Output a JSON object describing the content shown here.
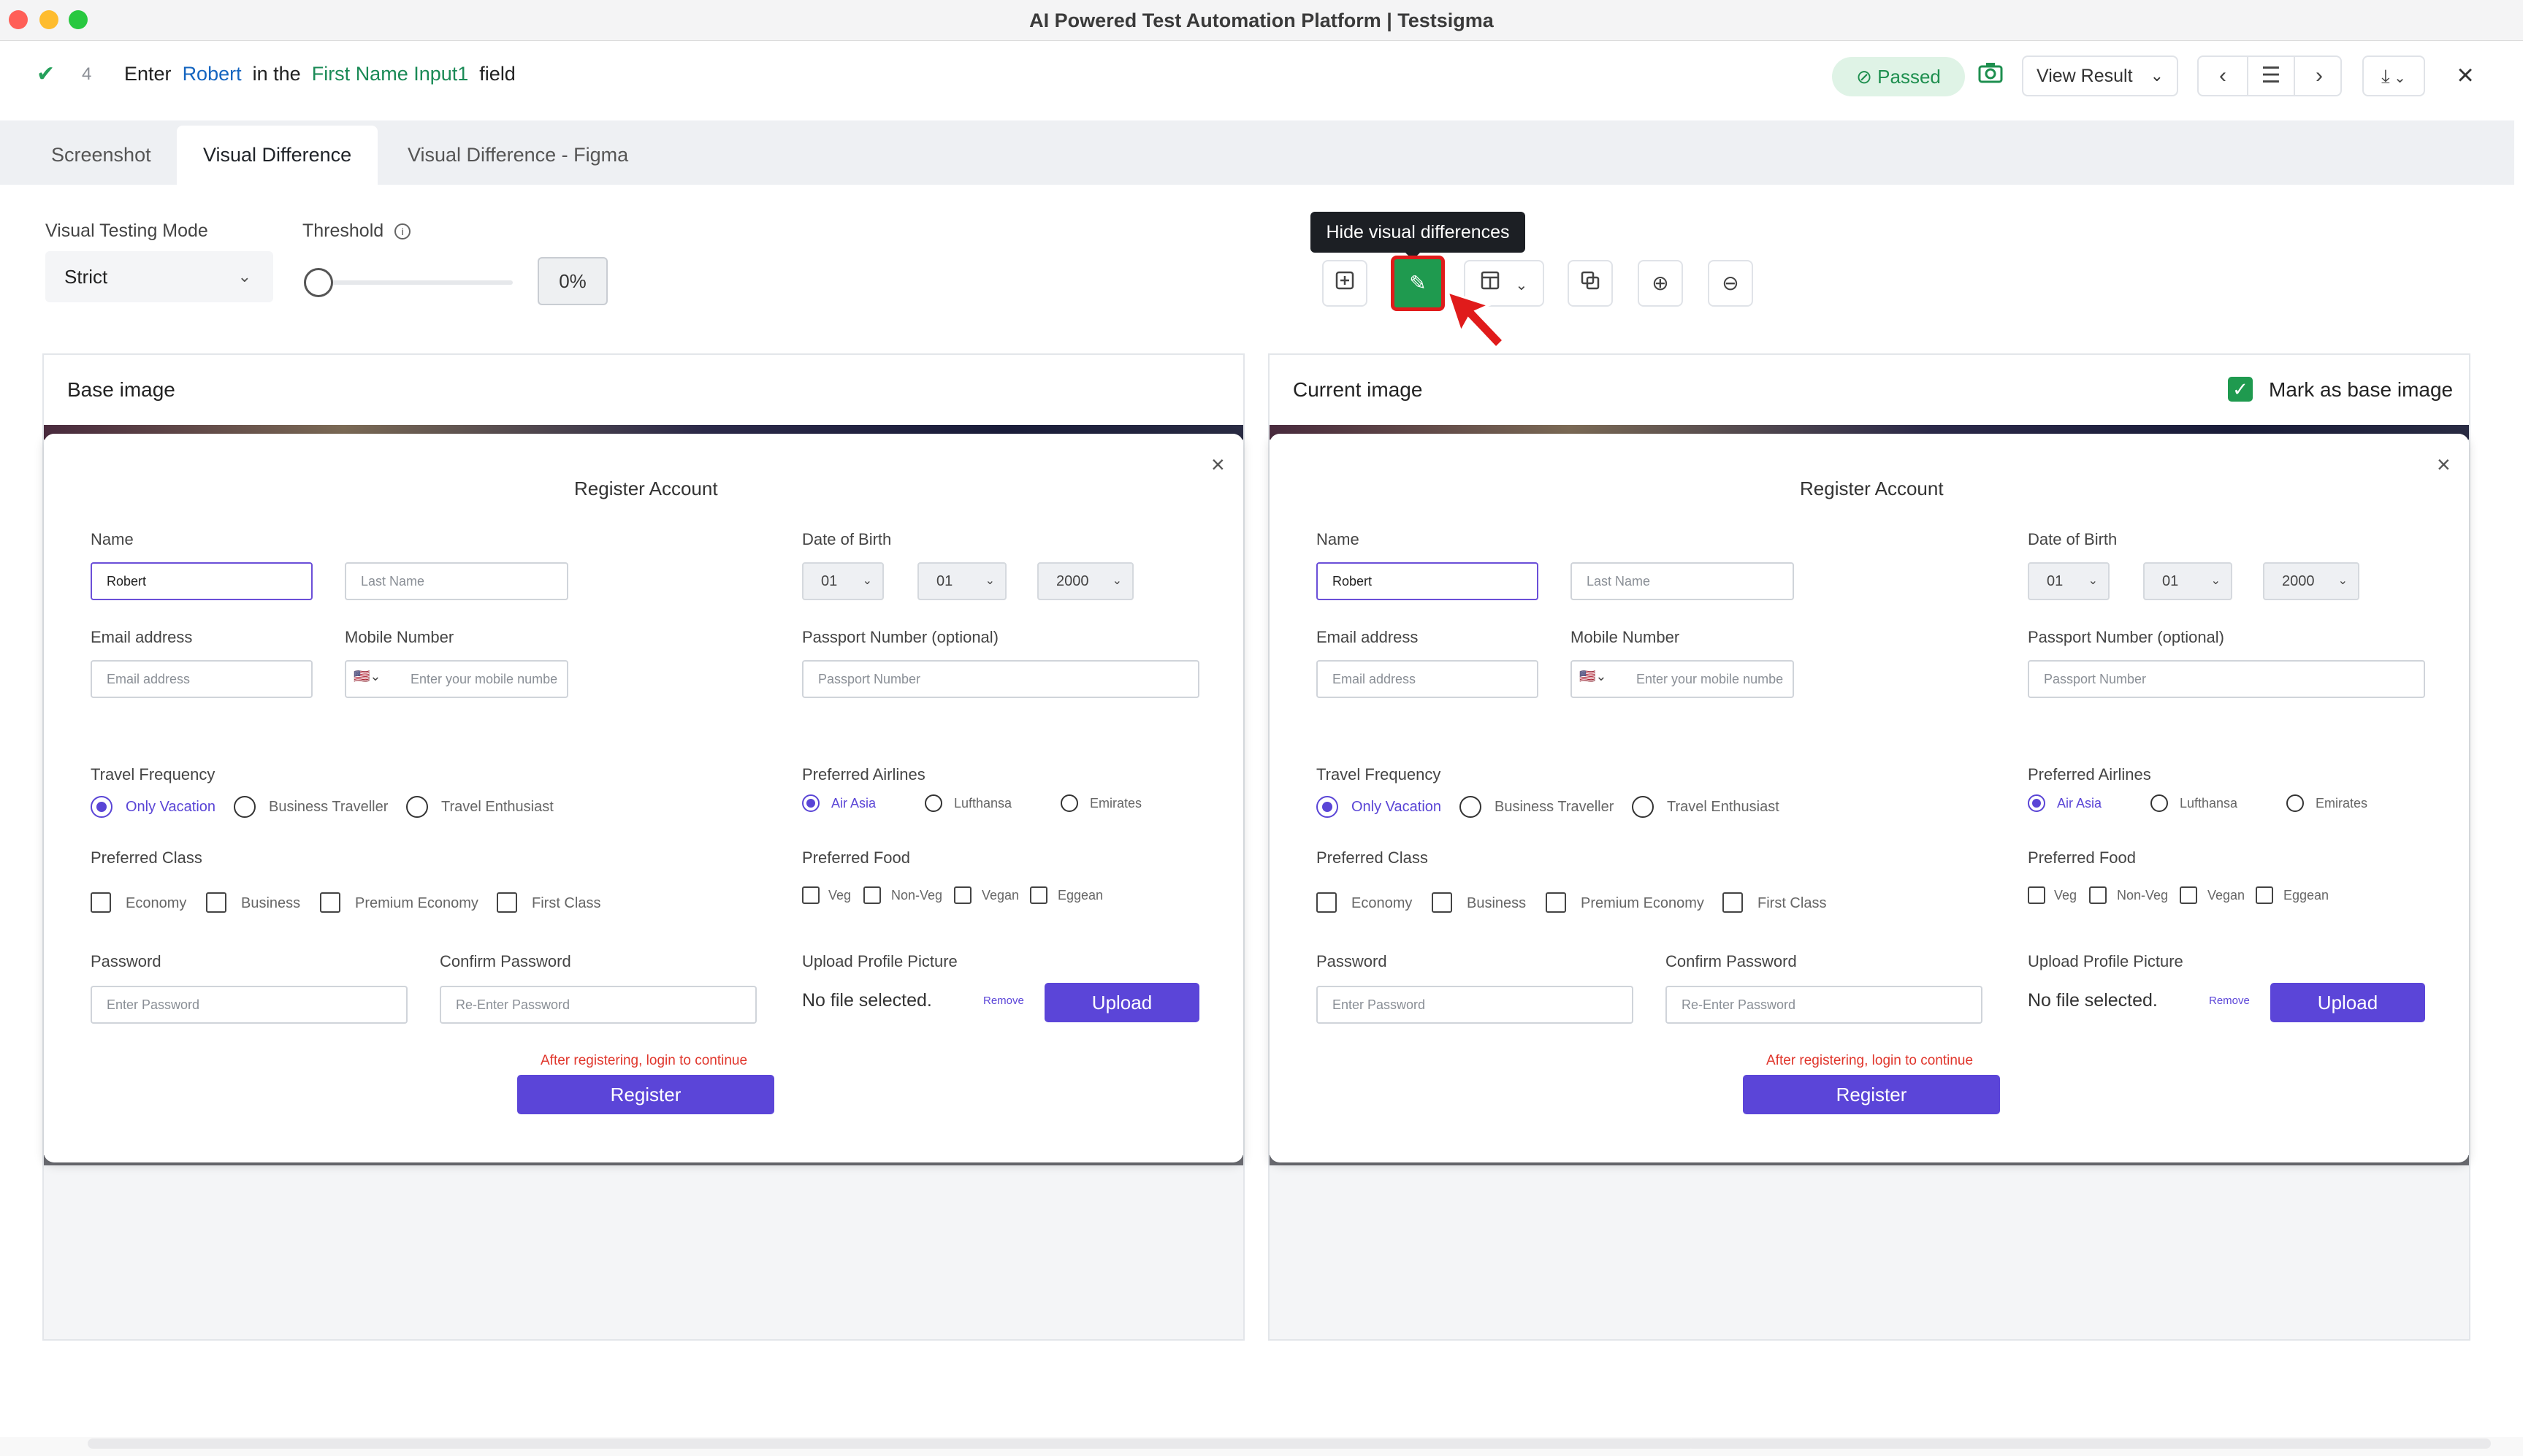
{
  "window": {
    "title": "AI Powered Test Automation Platform | Testsigma"
  },
  "step": {
    "number": "4",
    "text_enter": "Enter",
    "value": "Robert",
    "text_in_the": "in the",
    "element": "First Name Input1",
    "text_field": "field",
    "status": "Passed",
    "view_result": "View Result"
  },
  "tabs": [
    "Screenshot",
    "Visual Difference",
    "Visual Difference - Figma"
  ],
  "controls": {
    "mode_label": "Visual Testing Mode",
    "mode_value": "Strict",
    "threshold_label": "Threshold",
    "threshold_value": "0%",
    "threshold_level": 0,
    "tooltip": "Hide visual differences"
  },
  "panels": {
    "base_title": "Base image",
    "current_title": "Current image",
    "mark_as_base": "Mark as base image",
    "mark_as_base_checked": true
  },
  "form": {
    "title": "Register Account",
    "name_label": "Name",
    "first_name_value": "Robert",
    "last_name_placeholder": "Last Name",
    "dob_label": "Date of Birth",
    "dob_day": "01",
    "dob_month": "01",
    "dob_year": "2000",
    "email_label": "Email address",
    "email_placeholder": "Email address",
    "mobile_label": "Mobile Number",
    "mobile_placeholder": "Enter your mobile numbe",
    "passport_label": "Passport Number (optional)",
    "passport_placeholder": "Passport Number",
    "travel_label": "Travel Frequency",
    "travel_options": [
      "Only Vacation",
      "Business Traveller",
      "Travel Enthusiast"
    ],
    "airlines_label": "Preferred Airlines",
    "airline_options": [
      "Air Asia",
      "Lufthansa",
      "Emirates"
    ],
    "class_label": "Preferred Class",
    "class_options": [
      "Economy",
      "Business",
      "Premium Economy",
      "First Class"
    ],
    "food_label": "Preferred Food",
    "food_options": [
      "Veg",
      "Non-Veg",
      "Vegan",
      "Eggean"
    ],
    "password_label": "Password",
    "password_placeholder": "Enter Password",
    "confirm_label": "Confirm Password",
    "confirm_placeholder": "Re-Enter Password",
    "upload_label": "Upload Profile Picture",
    "no_file": "No file selected.",
    "remove": "Remove",
    "upload": "Upload",
    "hint": "After registering, login to continue",
    "register": "Register"
  },
  "colors": {
    "accent": "#5b45d8",
    "success": "#1f9a4f",
    "error": "#e0362c"
  }
}
